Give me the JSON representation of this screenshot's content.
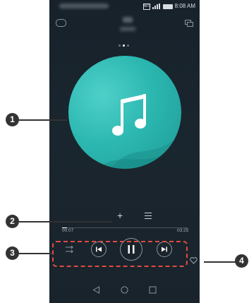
{
  "status_bar": {
    "time": "8:08 AM",
    "nfc_label": "NFC"
  },
  "player": {
    "progress_fraction": 0.04,
    "elapsed": "00:07",
    "duration": "03:25"
  },
  "callouts": [
    "1",
    "2",
    "3",
    "4"
  ],
  "colors": {
    "accent": "#2cb8b1",
    "callout": "#333333",
    "highlight": "#e04b43",
    "background": "#19232b"
  },
  "icons": [
    "lock-icon",
    "screen-switch-icon",
    "music-note-icon",
    "add-icon",
    "playlist-icon",
    "shuffle-icon",
    "previous-icon",
    "pause-icon",
    "next-icon",
    "favorite-icon",
    "back-icon",
    "home-icon",
    "recents-icon"
  ]
}
